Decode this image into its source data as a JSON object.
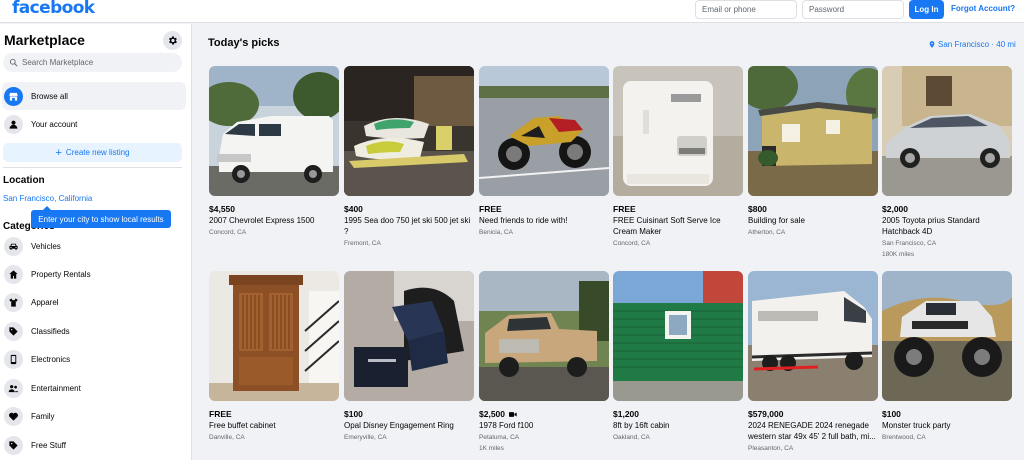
{
  "topbar": {
    "logo": "facebook",
    "email_placeholder": "Email or phone",
    "password_placeholder": "Password",
    "login_label": "Log In",
    "forgot_label": "Forgot Account?"
  },
  "sidebar": {
    "title": "Marketplace",
    "search_placeholder": "Search Marketplace",
    "nav": [
      {
        "label": "Browse all",
        "icon": "storefront-icon",
        "active": true
      },
      {
        "label": "Your account",
        "icon": "person-icon",
        "active": false
      }
    ],
    "create_label": "Create new listing",
    "location_heading": "Location",
    "location_value": "San Francisco, California",
    "tooltip": "Enter your city to show local results",
    "categories_heading": "Categories",
    "categories": [
      {
        "label": "Vehicles",
        "icon": "car-icon"
      },
      {
        "label": "Property Rentals",
        "icon": "house-icon"
      },
      {
        "label": "Apparel",
        "icon": "shirt-icon"
      },
      {
        "label": "Classifieds",
        "icon": "tag-icon"
      },
      {
        "label": "Electronics",
        "icon": "phone-icon"
      },
      {
        "label": "Entertainment",
        "icon": "people-icon"
      },
      {
        "label": "Family",
        "icon": "heart-icon"
      },
      {
        "label": "Free Stuff",
        "icon": "tag-icon"
      }
    ]
  },
  "main": {
    "title": "Today's picks",
    "location_chip": "San Francisco · 40 mi"
  },
  "listings": [
    {
      "price": "$4,550",
      "title": "2007 Chevrolet Express 1500",
      "location": "Concord, CA",
      "extra": ""
    },
    {
      "price": "$400",
      "title": "1995 Sea doo 750 jet ski 500 jet ski ?",
      "location": "Fremont, CA",
      "extra": ""
    },
    {
      "price": "FREE",
      "title": "Need friends to ride with!",
      "location": "Benicia, CA",
      "extra": ""
    },
    {
      "price": "FREE",
      "title": "FREE Cuisinart Soft Serve Ice Cream Maker",
      "location": "Concord, CA",
      "extra": ""
    },
    {
      "price": "$800",
      "title": "Building for sale",
      "location": "Atherton, CA",
      "extra": ""
    },
    {
      "price": "$2,000",
      "title": "2005 Toyota prius Standard Hatchback 4D",
      "location": "San Francisco, CA",
      "extra": "180K miles"
    },
    {
      "price": "FREE",
      "title": "Free buffet cabinet",
      "location": "Danville, CA",
      "extra": ""
    },
    {
      "price": "$100",
      "title": "Opal Disney Engagement Ring",
      "location": "Emeryville, CA",
      "extra": ""
    },
    {
      "price": "$2,500",
      "title": "1978 Ford f100",
      "location": "Petaluma, CA",
      "extra": "1K miles",
      "badge": "video-icon"
    },
    {
      "price": "$1,200",
      "title": "8ft by 16ft cabin",
      "location": "Oakland, CA",
      "extra": ""
    },
    {
      "price": "$579,000",
      "title": "2024 RENEGADE 2024 renegade western star 49x 45' 2 full bath, mi...",
      "location": "Pleasanton, CA",
      "extra": ""
    },
    {
      "price": "$100",
      "title": "Monster truck party",
      "location": "Brentwood, CA",
      "extra": ""
    }
  ],
  "colors": {
    "accent": "#1877f2",
    "page_bg": "#f0f2f5",
    "secondary_text": "#65676b"
  }
}
